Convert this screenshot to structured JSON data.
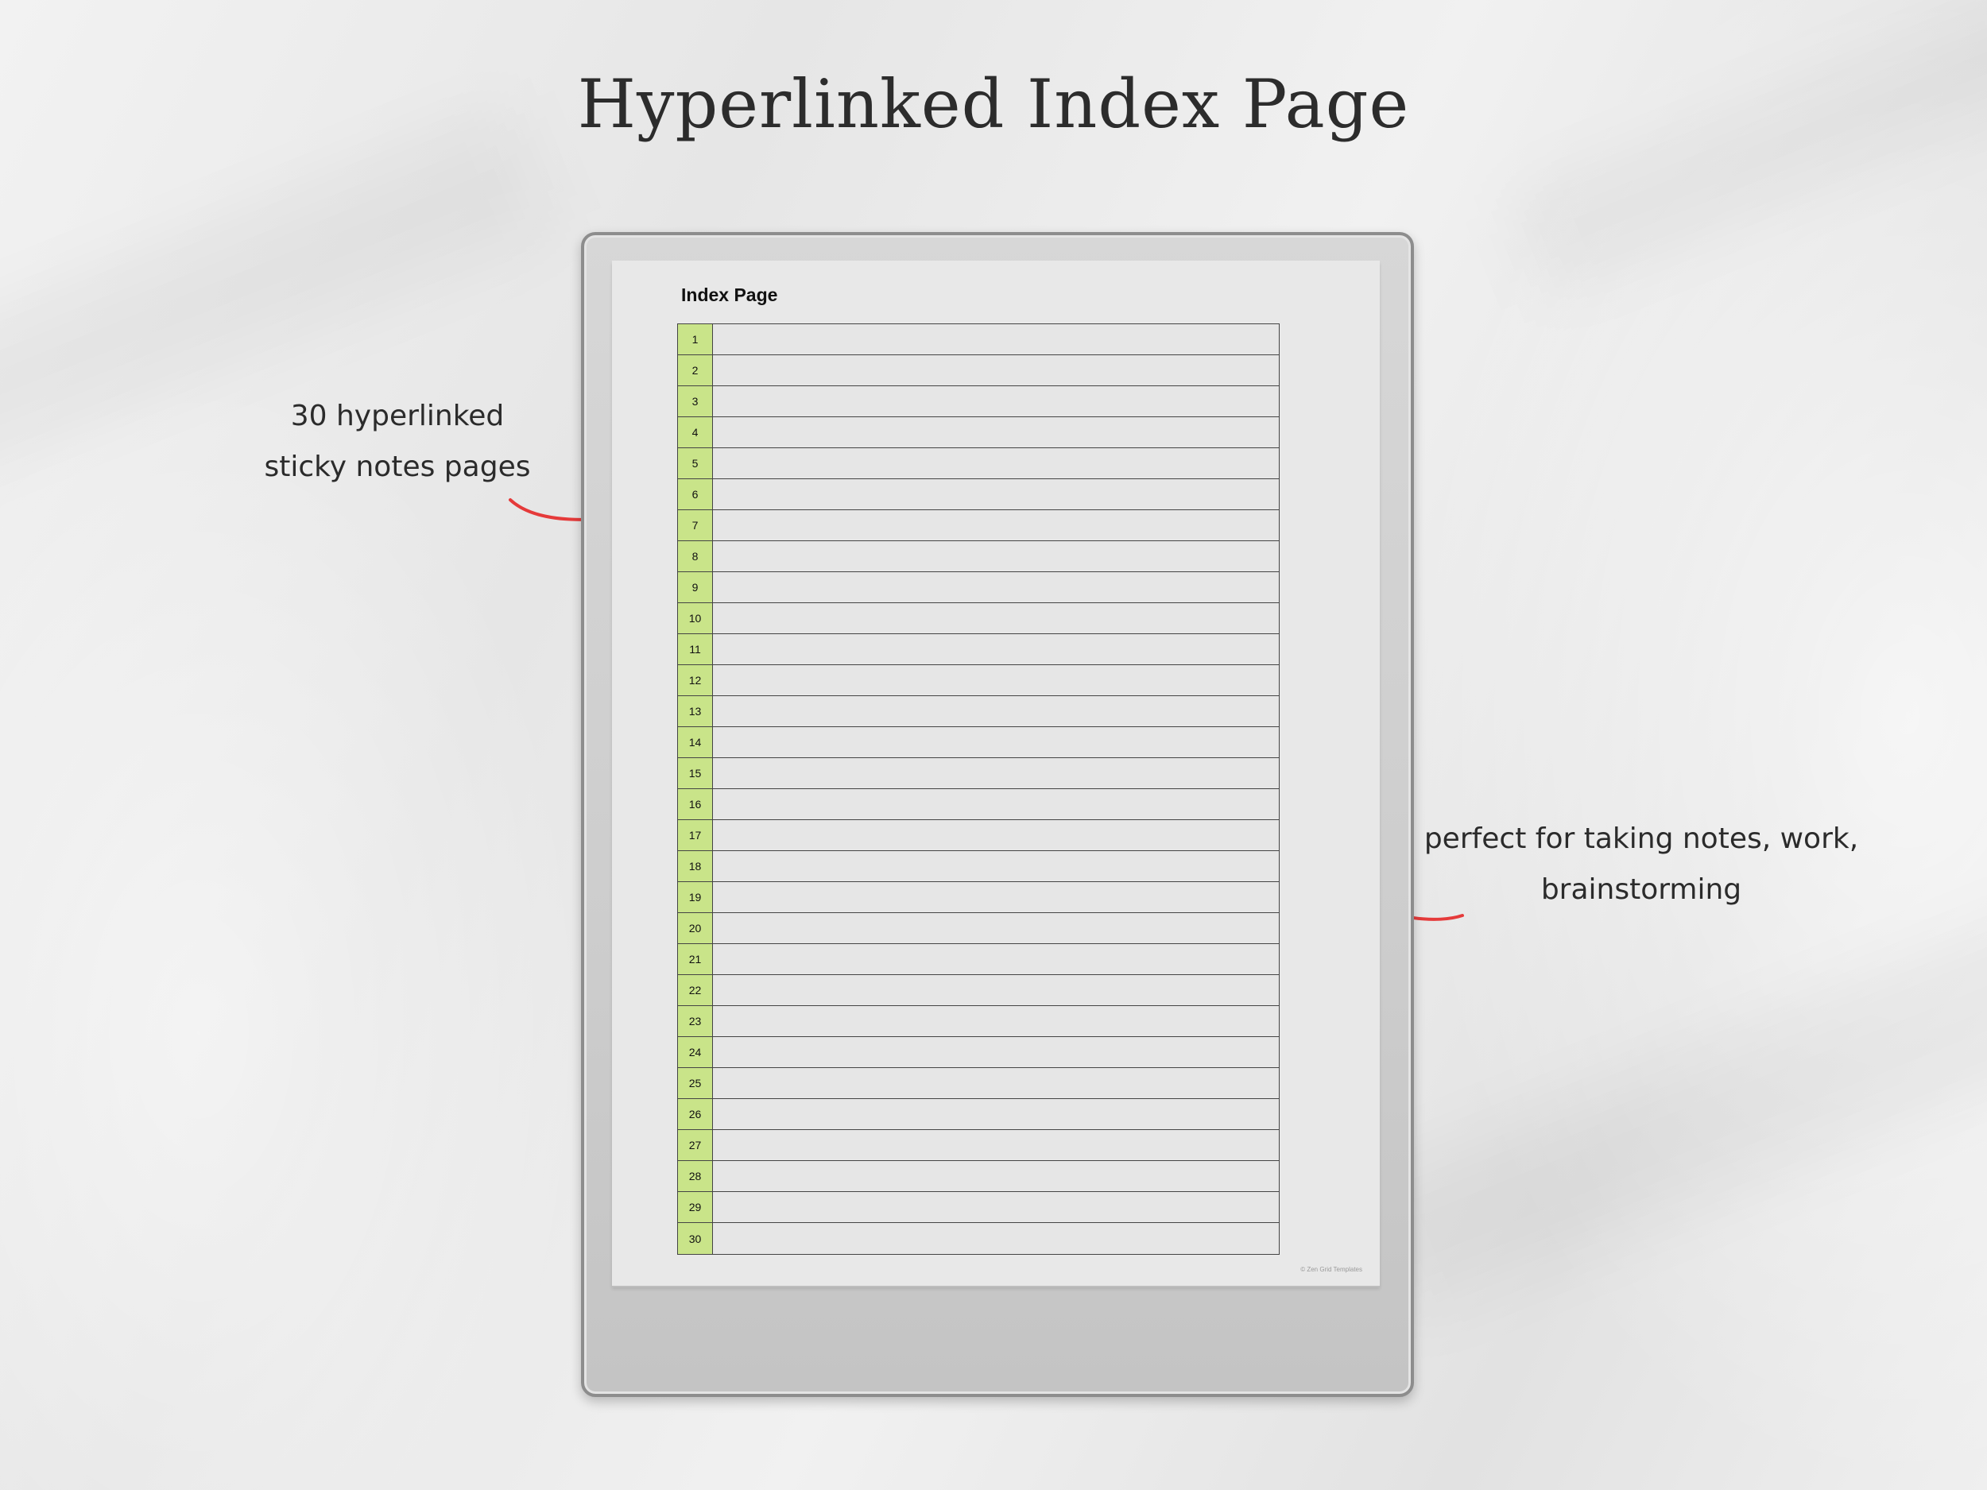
{
  "heading": "Hyperlinked Index Page",
  "callouts": {
    "left": {
      "line1": "30 hyperlinked",
      "line2": "sticky notes pages"
    },
    "right": {
      "line1": "perfect for taking notes, work,",
      "line2": "brainstorming"
    }
  },
  "colors": {
    "arrow": "#e53a3a",
    "index_cell": "#c9e489",
    "screen": "#e8e8e8"
  },
  "screen": {
    "title": "Index Page",
    "rows": [
      "1",
      "2",
      "3",
      "4",
      "5",
      "6",
      "7",
      "8",
      "9",
      "10",
      "11",
      "12",
      "13",
      "14",
      "15",
      "16",
      "17",
      "18",
      "19",
      "20",
      "21",
      "22",
      "23",
      "24",
      "25",
      "26",
      "27",
      "28",
      "29",
      "30"
    ],
    "copyright": "© Zen Grid Templates"
  }
}
